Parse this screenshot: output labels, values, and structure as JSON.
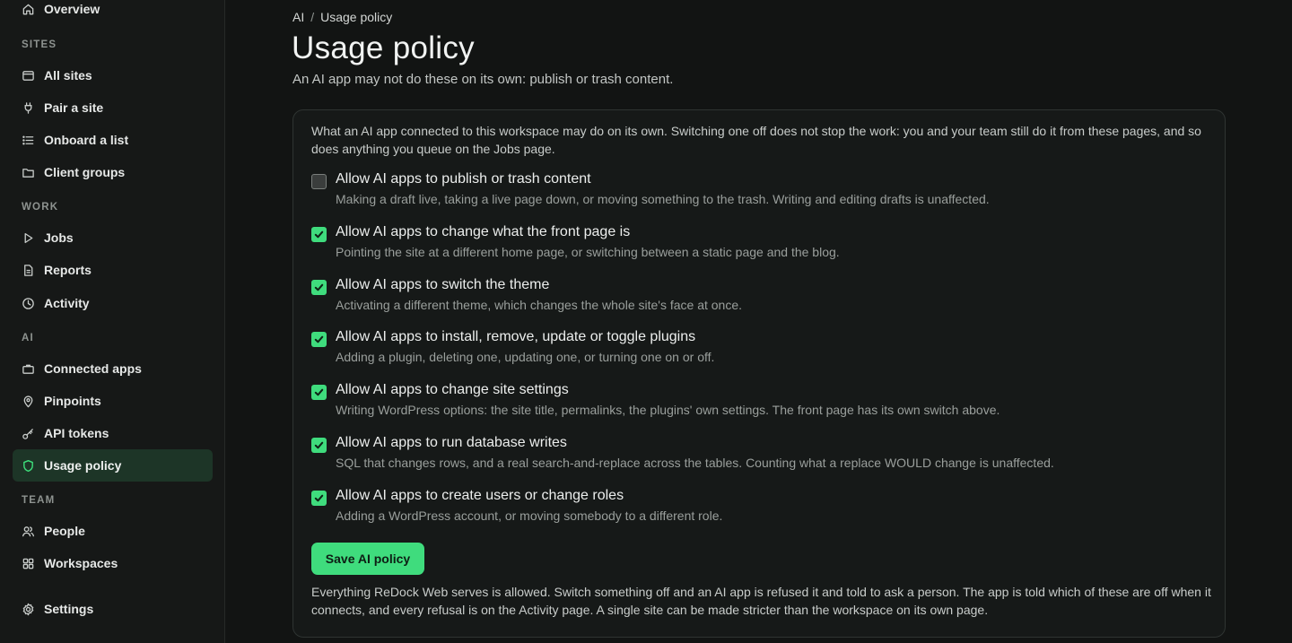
{
  "sidebar": {
    "overview": "Overview",
    "sites_title": "SITES",
    "all_sites": "All sites",
    "pair_site": "Pair a site",
    "onboard_list": "Onboard a list",
    "client_groups": "Client groups",
    "work_title": "WORK",
    "jobs": "Jobs",
    "reports": "Reports",
    "activity": "Activity",
    "ai_title": "AI",
    "connected_apps": "Connected apps",
    "pinpoints": "Pinpoints",
    "api_tokens": "API tokens",
    "usage_policy": "Usage policy",
    "team_title": "TEAM",
    "people": "People",
    "workspaces": "Workspaces",
    "settings": "Settings"
  },
  "breadcrumb": {
    "parent": "AI",
    "separator": "/",
    "current": "Usage policy"
  },
  "page": {
    "title": "Usage policy",
    "subtitle": "An AI app may not do these on its own: publish or trash content."
  },
  "panel": {
    "intro": "What an AI app connected to this workspace may do on its own. Switching one off does not stop the work: you and your team still do it from these pages, and so does anything you queue on the Jobs page.",
    "policies": [
      {
        "label": "Allow AI apps to publish or trash content",
        "description": "Making a draft live, taking a live page down, or moving something to the trash. Writing and editing drafts is unaffected.",
        "checked": false
      },
      {
        "label": "Allow AI apps to change what the front page is",
        "description": "Pointing the site at a different home page, or switching between a static page and the blog.",
        "checked": true
      },
      {
        "label": "Allow AI apps to switch the theme",
        "description": "Activating a different theme, which changes the whole site's face at once.",
        "checked": true
      },
      {
        "label": "Allow AI apps to install, remove, update or toggle plugins",
        "description": "Adding a plugin, deleting one, updating one, or turning one on or off.",
        "checked": true
      },
      {
        "label": "Allow AI apps to change site settings",
        "description": "Writing WordPress options: the site title, permalinks, the plugins' own settings. The front page has its own switch above.",
        "checked": true
      },
      {
        "label": "Allow AI apps to run database writes",
        "description": "SQL that changes rows, and a real search-and-replace across the tables. Counting what a replace WOULD change is unaffected.",
        "checked": true
      },
      {
        "label": "Allow AI apps to create users or change roles",
        "description": "Adding a WordPress account, or moving somebody to a different role.",
        "checked": true
      }
    ],
    "save_label": "Save AI policy",
    "footer": "Everything ReDock Web serves is allowed. Switch something off and an AI app is refused it and told to ask a person. The app is told which of these are off when it connects, and every refusal is on the Activity page. A single site can be made stricter than the workspace on its own page."
  },
  "colors": {
    "accent": "#3fdc7d",
    "background": "#121413",
    "sidebar_background": "#161817",
    "active_item_background": "#1d3527"
  }
}
